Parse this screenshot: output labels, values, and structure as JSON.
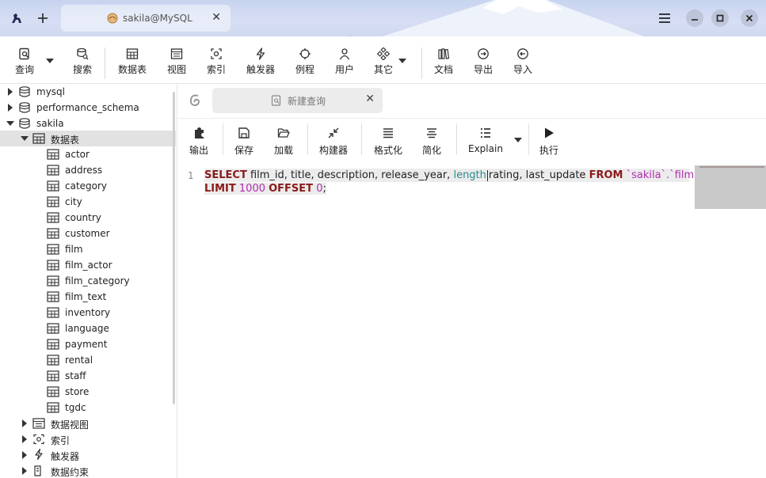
{
  "titlebar": {
    "connection_tab": "sakila@MySQL",
    "close_glyph": "✕",
    "app_icon": "kangaroo-icon",
    "new_tab_icon": "plus-icon",
    "window_buttons": [
      "menu-icon",
      "minimize-icon",
      "maximize-icon",
      "close-icon"
    ]
  },
  "toolbar": {
    "query": "查询",
    "search": "搜索",
    "tables": "数据表",
    "views": "视图",
    "indexes": "索引",
    "triggers": "触发器",
    "routines": "例程",
    "users": "用户",
    "others": "其它",
    "docs": "文档",
    "export": "导出",
    "import": "导入"
  },
  "sidebar": {
    "databases": [
      {
        "name": "mysql",
        "expanded": false
      },
      {
        "name": "performance_schema",
        "expanded": false
      },
      {
        "name": "sakila",
        "expanded": true
      }
    ],
    "tables_folder": "数据表",
    "tables": [
      "actor",
      "address",
      "category",
      "city",
      "country",
      "customer",
      "film",
      "film_actor",
      "film_category",
      "film_text",
      "inventory",
      "language",
      "payment",
      "rental",
      "staff",
      "store",
      "tgdc"
    ],
    "views_folder": "数据视图",
    "indexes_folder": "索引",
    "triggers_folder": "触发器",
    "constraints_folder": "数据约束"
  },
  "query_tab": {
    "label": "新建查询",
    "close_glyph": "✕"
  },
  "query_toolbar": {
    "output": "输出",
    "save": "保存",
    "load": "加载",
    "builder": "构建器",
    "format": "格式化",
    "simplify": "简化",
    "explain": "Explain",
    "execute": "执行"
  },
  "editor": {
    "line_number": "1",
    "sql": {
      "kw_select": "SELECT",
      "cols_a": " film_id, title, description, release_year, ",
      "fn_length": "length",
      "cols_b": "rating, last_update ",
      "kw_from": "FROM",
      "tbl": " `sakila`.`film`",
      "kw_limit": "LIMIT",
      "n_limit": " 1000 ",
      "kw_offset": "OFFSET",
      "n_offset": " 0",
      "end": ";"
    }
  },
  "colors": {
    "keyword": "#8b1a1a",
    "function": "#2a8a8a",
    "literal": "#b02cb0"
  }
}
